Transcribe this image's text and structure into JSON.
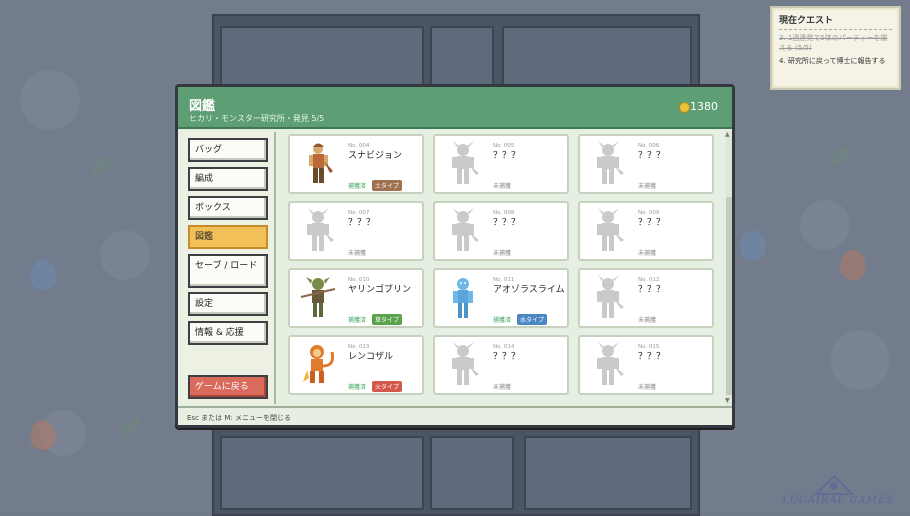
{
  "quest": {
    "title": "現在クエスト",
    "items": [
      {
        "text": "3. 1週連発で5体のパーティーを揃える (5/5)",
        "done": true
      },
      {
        "text": "4. 研究所に戻って博士に報告する",
        "done": false
      }
    ]
  },
  "header": {
    "title": "図鑑",
    "subtitle": "ヒカリ・モンスター研究所・発見 5/5",
    "money": "1380"
  },
  "sidebar": {
    "items": [
      {
        "label": "バッグ",
        "active": false
      },
      {
        "label": "編成",
        "active": false
      },
      {
        "label": "ボックス",
        "active": false
      },
      {
        "label": "図鑑",
        "active": true
      },
      {
        "label": "セーブ / ロード",
        "active": false
      },
      {
        "label": "設定",
        "active": false
      },
      {
        "label": "情報 & 応援",
        "active": false
      }
    ],
    "back_label": "ゲームに戻る"
  },
  "entries": [
    {
      "no": "No. 004",
      "name": "スナビジョン",
      "status": "捕獲済",
      "type": "土タイプ",
      "type_color": "#a0714f",
      "caught": true,
      "sprite": "ranger"
    },
    {
      "no": "No. 005",
      "name": "？？？",
      "status": "未捕獲",
      "caught": false
    },
    {
      "no": "No. 006",
      "name": "？？？",
      "status": "未捕獲",
      "caught": false
    },
    {
      "no": "No. 007",
      "name": "？？？",
      "status": "未捕獲",
      "caught": false
    },
    {
      "no": "No. 008",
      "name": "？？？",
      "status": "未捕獲",
      "caught": false
    },
    {
      "no": "No. 009",
      "name": "？？？",
      "status": "未捕獲",
      "caught": false
    },
    {
      "no": "No. 010",
      "name": "ヤリンゴブリン",
      "status": "捕獲済",
      "type": "草タイプ",
      "type_color": "#5aa34c",
      "caught": true,
      "sprite": "goblin"
    },
    {
      "no": "No. 011",
      "name": "アオゾラスライム",
      "status": "捕獲済",
      "type": "水タイプ",
      "type_color": "#4a86c4",
      "caught": true,
      "sprite": "slime"
    },
    {
      "no": "No. 012",
      "name": "？？？",
      "status": "未捕獲",
      "caught": false
    },
    {
      "no": "No. 013",
      "name": "レンコザル",
      "status": "捕獲済",
      "type": "火タイプ",
      "type_color": "#d4584a",
      "caught": true,
      "sprite": "monkey"
    },
    {
      "no": "No. 014",
      "name": "？？？",
      "status": "未捕獲",
      "caught": false
    },
    {
      "no": "No. 015",
      "name": "？？？",
      "status": "未捕獲",
      "caught": false
    }
  ],
  "footer": {
    "hint": "Esc または M: メニューを閉じる"
  }
}
